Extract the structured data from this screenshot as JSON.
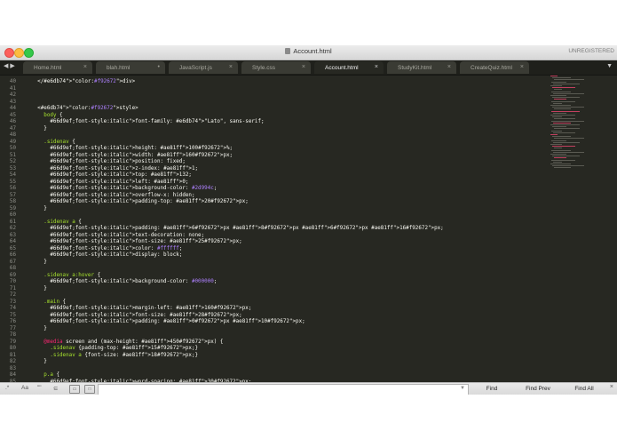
{
  "window": {
    "title": "Account.html",
    "unregistered": "UNREGISTERED"
  },
  "tabs": [
    {
      "label": "Home.html",
      "close": "×"
    },
    {
      "label": "blah.html",
      "close": "•"
    },
    {
      "label": "JavaScript.js",
      "close": "×"
    },
    {
      "label": "Style.css",
      "close": "×"
    },
    {
      "label": "Account.html",
      "close": "×",
      "active": true
    },
    {
      "label": "StudyKit.html",
      "close": "×"
    },
    {
      "label": "CreateQuiz.html",
      "close": "×"
    }
  ],
  "nav_arrows": "◀ ▶",
  "tab_menu_icon": "▼",
  "code_lines": [
    {
      "n": "40",
      "t": "    </div>"
    },
    {
      "n": "41",
      "t": ""
    },
    {
      "n": "42",
      "t": ""
    },
    {
      "n": "43",
      "t": ""
    },
    {
      "n": "44",
      "t": "    <style>"
    },
    {
      "n": "45",
      "t": "      body {"
    },
    {
      "n": "46",
      "t": "        font-family: \"Lato\", sans-serif;"
    },
    {
      "n": "47",
      "t": "      }"
    },
    {
      "n": "48",
      "t": ""
    },
    {
      "n": "49",
      "t": "      .sidenav {"
    },
    {
      "n": "50",
      "t": "        height: 100%;"
    },
    {
      "n": "51",
      "t": "        width: 160px;"
    },
    {
      "n": "52",
      "t": "        position: fixed;"
    },
    {
      "n": "53",
      "t": "        z-index: 1;"
    },
    {
      "n": "54",
      "t": "        top: 132;"
    },
    {
      "n": "55",
      "t": "        left: 0;"
    },
    {
      "n": "56",
      "t": "        background-color: #2d994c;"
    },
    {
      "n": "57",
      "t": "        overflow-x: hidden;"
    },
    {
      "n": "58",
      "t": "        padding-top: 20px;"
    },
    {
      "n": "59",
      "t": "      }"
    },
    {
      "n": "60",
      "t": ""
    },
    {
      "n": "61",
      "t": "      .sidenav a {"
    },
    {
      "n": "62",
      "t": "        padding: 6px 8px 6px 16px;"
    },
    {
      "n": "63",
      "t": "        text-decoration: none;"
    },
    {
      "n": "64",
      "t": "        font-size: 25px;"
    },
    {
      "n": "65",
      "t": "        color: #ffffff;"
    },
    {
      "n": "66",
      "t": "        display: block;"
    },
    {
      "n": "67",
      "t": "      }"
    },
    {
      "n": "68",
      "t": ""
    },
    {
      "n": "69",
      "t": "      .sidenav a:hover {"
    },
    {
      "n": "70",
      "t": "        background-color: #000000;"
    },
    {
      "n": "71",
      "t": "      }"
    },
    {
      "n": "72",
      "t": ""
    },
    {
      "n": "73",
      "t": "      .main {"
    },
    {
      "n": "74",
      "t": "        margin-left: 160px;"
    },
    {
      "n": "75",
      "t": "        font-size: 28px;"
    },
    {
      "n": "76",
      "t": "        padding: 0px 10px;"
    },
    {
      "n": "77",
      "t": "      }"
    },
    {
      "n": "78",
      "t": ""
    },
    {
      "n": "79",
      "t": "      @media screen and (max-height: 450px) {"
    },
    {
      "n": "80",
      "t": "        .sidenav {padding-top: 15px;}"
    },
    {
      "n": "81",
      "t": "        .sidenav a {font-size: 18px;}"
    },
    {
      "n": "82",
      "t": "      }"
    },
    {
      "n": "83",
      "t": ""
    },
    {
      "n": "84",
      "t": "      p.a {"
    },
    {
      "n": "85",
      "t": "        word-spacing: 30px;"
    }
  ],
  "findbar": {
    "options": [
      ".*",
      "Aa",
      "\"\"",
      "⊆",
      "▭",
      "□"
    ],
    "input_value": "",
    "find": "Find",
    "find_prev": "Find Prev",
    "find_all": "Find All",
    "close": "×"
  },
  "colors": {
    "editor_bg": "#272822",
    "tag": "#f92672",
    "property": "#66d9ef",
    "number": "#ae81ff",
    "string": "#e6db74",
    "selector": "#a6e22e"
  }
}
